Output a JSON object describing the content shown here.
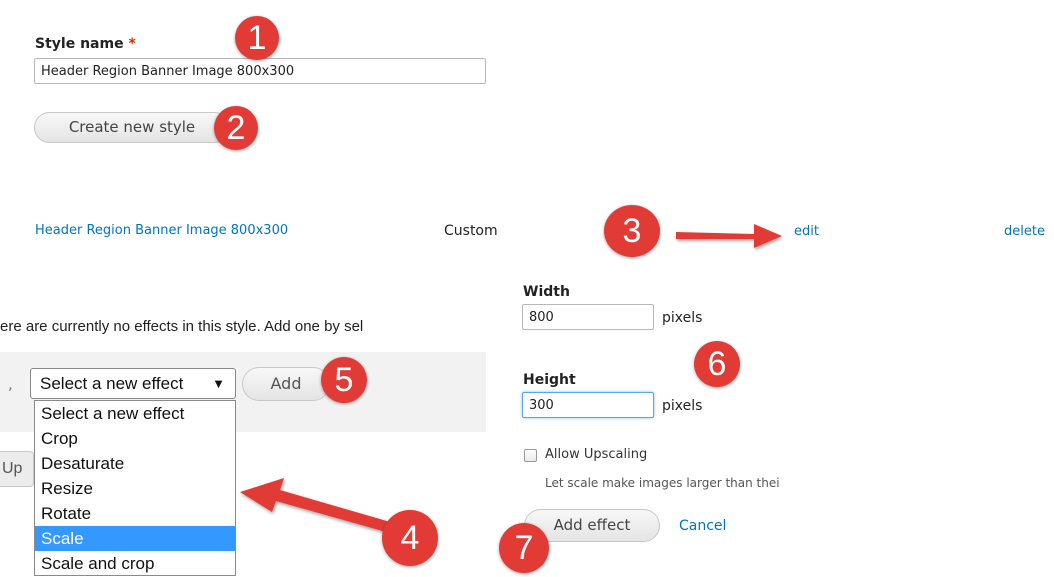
{
  "style_form": {
    "label": "Style name",
    "required_mark": "*",
    "value": "Header Region Banner Image 800x300",
    "create_button": "Create new style"
  },
  "styles_row": {
    "name": "Header Region Banner Image 800x300",
    "status": "Custom",
    "edit": "edit",
    "delete": "delete"
  },
  "effects": {
    "partial_message": "ere are currently no effects in this style. Add one by sel",
    "select_value": "Select a new effect",
    "select_arrow": "▼",
    "add_button": "Add",
    "options": [
      "Select a new effect",
      "Crop",
      "Desaturate",
      "Resize",
      "Rotate",
      "Scale",
      "Scale and crop"
    ],
    "selected_option": "Scale",
    "partial_update_button": "Up"
  },
  "scale_form": {
    "width_label": "Width",
    "width_value": "800",
    "width_unit": "pixels",
    "height_label": "Height",
    "height_value": "300",
    "height_unit": "pixels",
    "upscale_label": "Allow Upscaling",
    "upscale_checked": false,
    "upscale_description": "Let scale make images larger than thei",
    "add_effect_button": "Add effect",
    "cancel_link": "Cancel"
  },
  "annotations": {
    "badges": [
      "1",
      "2",
      "3",
      "4",
      "5",
      "6",
      "7"
    ],
    "badge_color": "#e23b36"
  },
  "colors": {
    "link": "#0074bd",
    "required": "#e32700",
    "selected_option": "#3399ff"
  }
}
